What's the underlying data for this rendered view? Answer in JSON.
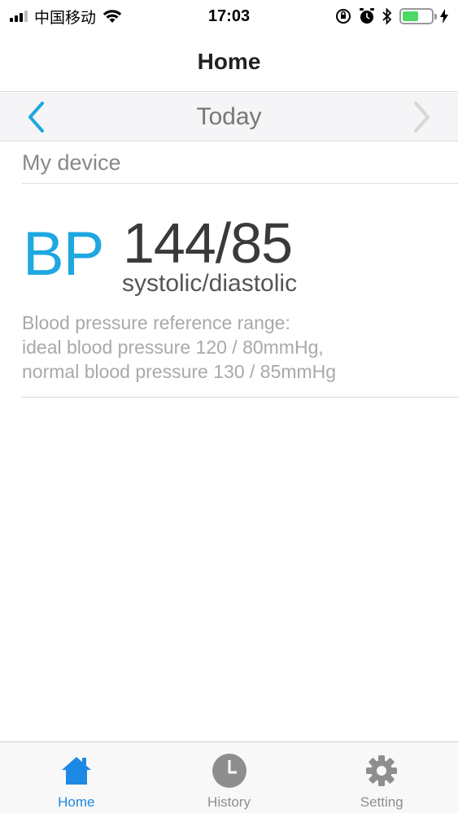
{
  "status_bar": {
    "carrier": "中国移动",
    "time": "17:03"
  },
  "nav": {
    "title": "Home"
  },
  "date_bar": {
    "label": "Today"
  },
  "section": {
    "label": "My device"
  },
  "reading": {
    "tag": "BP",
    "value": "144/85",
    "units": "systolic/diastolic",
    "reference": [
      "Blood pressure reference range:",
      "ideal blood pressure 120 / 80mmHg,",
      "normal blood pressure 130 / 85mmHg"
    ]
  },
  "tabs": [
    {
      "label": "Home",
      "icon": "home-icon",
      "active": true
    },
    {
      "label": "History",
      "icon": "clock-icon",
      "active": false
    },
    {
      "label": "Setting",
      "icon": "gear-icon",
      "active": false
    }
  ],
  "colors": {
    "accent": "#1ea7e0",
    "tab_active": "#1e88e5",
    "battery": "#4cd964"
  },
  "battery_level": 0.55
}
